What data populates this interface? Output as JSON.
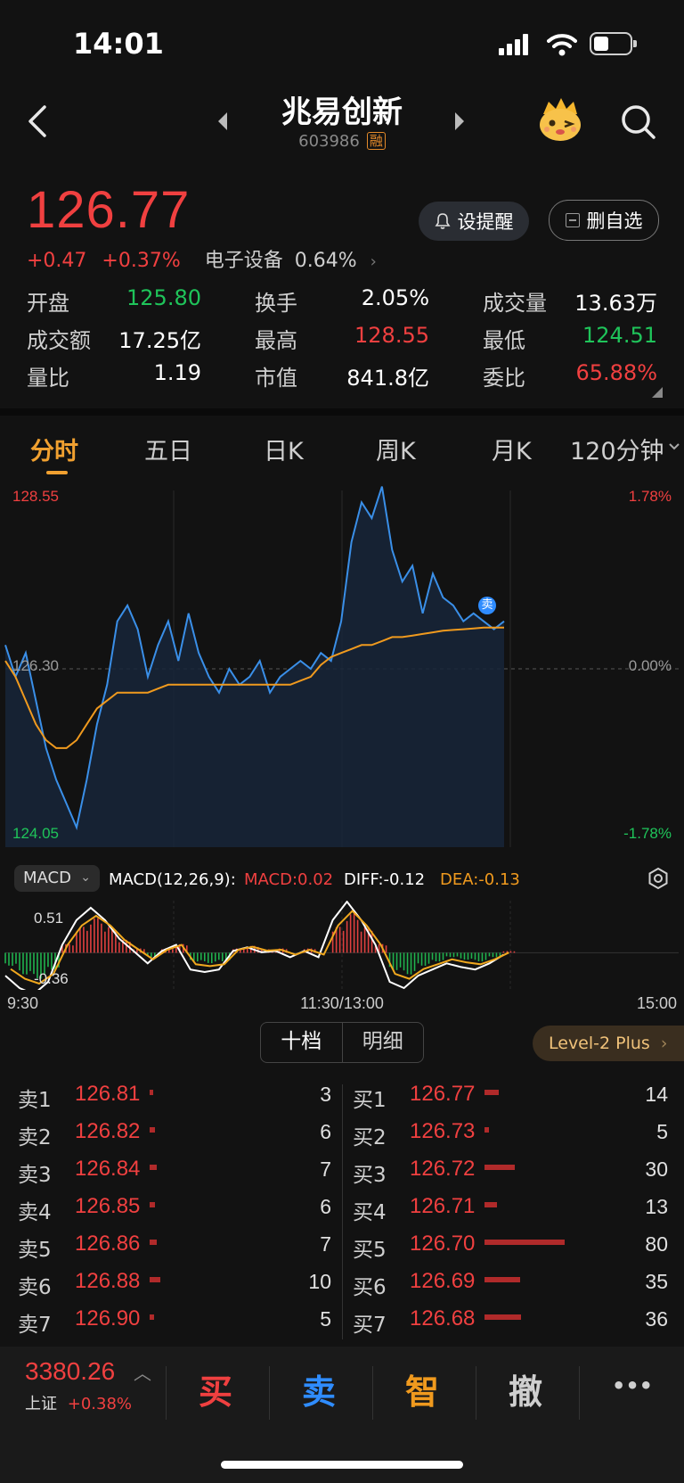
{
  "status_bar": {
    "time": "14:01"
  },
  "header": {
    "stock_name": "兆易创新",
    "stock_code": "603986",
    "margin_badge": "融"
  },
  "quote": {
    "price": "126.77",
    "change": "+0.47",
    "change_pct": "+0.37%",
    "sector_name": "电子设备",
    "sector_pct": "0.64%",
    "alert_button": "设提醒",
    "watchlist_button": "删自选",
    "grid": [
      {
        "label": "开盘",
        "value": "125.80",
        "color": "green"
      },
      {
        "label": "换手",
        "value": "2.05%",
        "color": "white"
      },
      {
        "label": "成交量",
        "value": "13.63万",
        "color": "white"
      },
      {
        "label": "成交额",
        "value": "17.25亿",
        "color": "white"
      },
      {
        "label": "最高",
        "value": "128.55",
        "color": "red"
      },
      {
        "label": "最低",
        "value": "124.51",
        "color": "green"
      },
      {
        "label": "量比",
        "value": "1.19",
        "color": "white"
      },
      {
        "label": "市值",
        "value": "841.8亿",
        "color": "white"
      },
      {
        "label": "委比",
        "value": "65.88%",
        "color": "red"
      }
    ]
  },
  "tabs": [
    "分时",
    "五日",
    "日K",
    "周K",
    "月K",
    "120分钟"
  ],
  "active_tab": "分时",
  "chart": {
    "price_high": "128.55",
    "price_mid": "126.30",
    "price_low": "124.05",
    "pct_high": "1.78%",
    "pct_mid": "0.00%",
    "pct_low": "-1.78%",
    "sell_marker": "卖",
    "time_start": "9:30",
    "time_mid": "11:30/13:00",
    "time_end": "15:00"
  },
  "macd": {
    "selector": "MACD",
    "params": "MACD(12,26,9):",
    "macd": "MACD:0.02",
    "diff": "DIFF:-0.12",
    "dea": "DEA:-0.13",
    "axis_top": "0.51",
    "axis_bottom": "-0.36"
  },
  "chart_data": [
    {
      "type": "line",
      "series": [],
      "ylim": [
        124.05,
        128.55
      ],
      "x_labels": [
        "9:30",
        "11:30/13:00",
        "15:00"
      ],
      "price": [
        126.6,
        126.2,
        126.5,
        125.9,
        125.3,
        124.9,
        124.6,
        124.3,
        124.9,
        125.6,
        126.1,
        126.9,
        127.1,
        126.8,
        126.2,
        126.6,
        126.9,
        126.4,
        127.0,
        126.5,
        126.2,
        126.0,
        126.3,
        126.1,
        126.2,
        126.4,
        126.0,
        126.2,
        126.3,
        126.4,
        126.3,
        126.5,
        126.4,
        126.9,
        127.9,
        128.4,
        128.2,
        128.6,
        127.8,
        127.4,
        127.6,
        127.0,
        127.5,
        127.2,
        127.1,
        126.9,
        127.0,
        126.9,
        126.8,
        126.9
      ],
      "avg_price": [
        126.4,
        126.2,
        125.9,
        125.6,
        125.4,
        125.3,
        125.3,
        125.4,
        125.6,
        125.8,
        125.9,
        126.0,
        126.0,
        126.0,
        126.0,
        126.05,
        126.1,
        126.1,
        126.1,
        126.1,
        126.1,
        126.1,
        126.1,
        126.1,
        126.1,
        126.1,
        126.1,
        126.1,
        126.1,
        126.15,
        126.2,
        126.35,
        126.45,
        126.5,
        126.55,
        126.6,
        126.6,
        126.65,
        126.7,
        126.7,
        126.72,
        126.74,
        126.76,
        126.78,
        126.79,
        126.8,
        126.81,
        126.82,
        126.82,
        126.82
      ]
    },
    {
      "type": "bar",
      "series": [],
      "values": [
        -0.15,
        -0.25,
        -0.3,
        -0.2,
        0.1,
        0.3,
        0.4,
        0.3,
        0.15,
        0.05,
        -0.05,
        0.05,
        0.1,
        -0.1,
        -0.12,
        -0.1,
        0.05,
        0.08,
        0.04,
        0.05,
        0.0,
        0.05,
        0.0,
        0.3,
        0.45,
        0.3,
        0.1,
        -0.2,
        -0.25,
        -0.15,
        -0.1,
        -0.05,
        -0.08,
        -0.1,
        -0.05,
        0.02
      ],
      "ylim": [
        -0.36,
        0.51
      ]
    }
  ],
  "order_book": {
    "tabs": [
      "十档",
      "明细"
    ],
    "level2_button": "Level-2 Plus",
    "sell": [
      {
        "label": "卖1",
        "price": "126.81",
        "vol": "3",
        "bar": 0.04
      },
      {
        "label": "卖2",
        "price": "126.82",
        "vol": "6",
        "bar": 0.07
      },
      {
        "label": "卖3",
        "price": "126.84",
        "vol": "7",
        "bar": 0.09
      },
      {
        "label": "卖4",
        "price": "126.85",
        "vol": "6",
        "bar": 0.07
      },
      {
        "label": "卖5",
        "price": "126.86",
        "vol": "7",
        "bar": 0.09
      },
      {
        "label": "卖6",
        "price": "126.88",
        "vol": "10",
        "bar": 0.13
      },
      {
        "label": "卖7",
        "price": "126.90",
        "vol": "5",
        "bar": 0.06
      }
    ],
    "buy": [
      {
        "label": "买1",
        "price": "126.77",
        "vol": "14",
        "bar": 0.18
      },
      {
        "label": "买2",
        "price": "126.73",
        "vol": "5",
        "bar": 0.06
      },
      {
        "label": "买3",
        "price": "126.72",
        "vol": "30",
        "bar": 0.38
      },
      {
        "label": "买4",
        "price": "126.71",
        "vol": "13",
        "bar": 0.16
      },
      {
        "label": "买5",
        "price": "126.70",
        "vol": "80",
        "bar": 1.0
      },
      {
        "label": "买6",
        "price": "126.69",
        "vol": "35",
        "bar": 0.44
      },
      {
        "label": "买7",
        "price": "126.68",
        "vol": "36",
        "bar": 0.45
      }
    ]
  },
  "bottom_bar": {
    "index_value": "3380.26",
    "index_name": "上证",
    "index_pct": "+0.38%",
    "buy": "买",
    "sell": "卖",
    "smart": "智",
    "cancel": "撤",
    "more": "•••"
  }
}
